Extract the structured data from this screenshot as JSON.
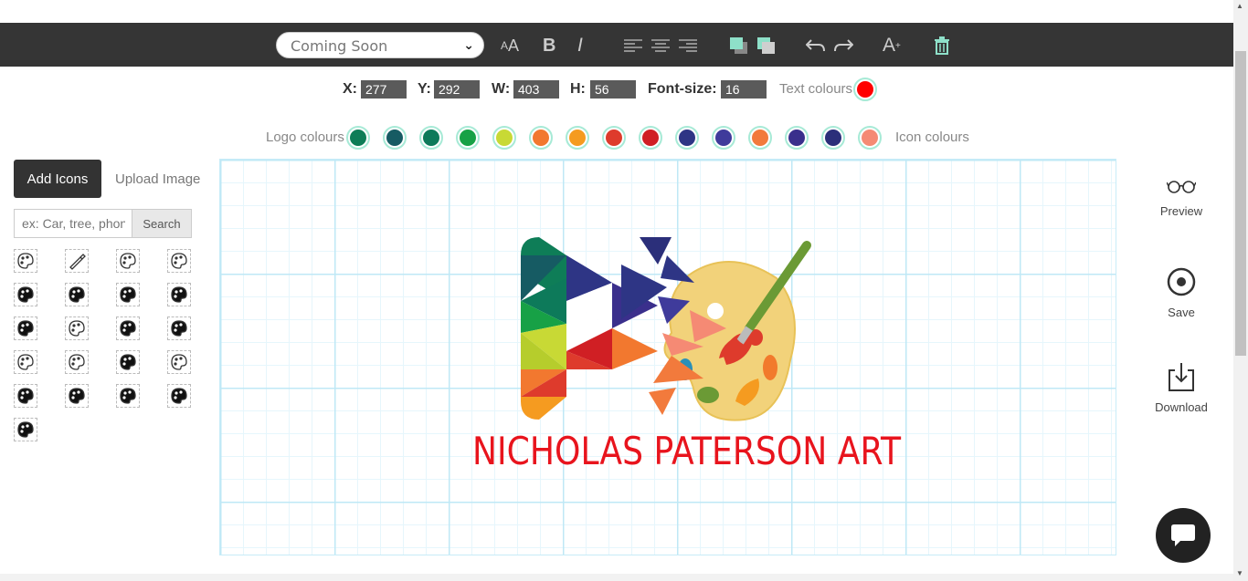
{
  "toolbar": {
    "font_value": "Coming Soon",
    "buttons": {
      "font_size": "AA",
      "bold": "B",
      "italic": "I"
    }
  },
  "coords": {
    "x_label": "X:",
    "x_value": "277",
    "y_label": "Y:",
    "y_value": "292",
    "w_label": "W:",
    "w_value": "403",
    "h_label": "H:",
    "h_value": "56",
    "fontsize_label": "Font-size:",
    "fontsize_value": "16",
    "text_colours_label": "Text colours",
    "text_colour": "#ff0000"
  },
  "palette": {
    "logo_colours_label": "Logo colours",
    "icon_colours_label": "Icon colours",
    "colors": [
      "#0e7d57",
      "#165b63",
      "#0d7a5a",
      "#17a146",
      "#c8d935",
      "#f2782f",
      "#f59b20",
      "#de3b2c",
      "#d01f24",
      "#2e3585",
      "#3f3b9b",
      "#f27a3c",
      "#3a2f8c",
      "#2b2f7a",
      "#f58a74"
    ]
  },
  "left_panel": {
    "add_icons_label": "Add Icons",
    "upload_image_label": "Upload Image",
    "search_placeholder": "ex: Car, tree, phone",
    "search_button": "Search",
    "icons": [
      "palette-icon",
      "brush-icon",
      "palette-icon",
      "palette-icon",
      "palette-icon",
      "palette-icon",
      "palette-icon",
      "palette-icon",
      "palette-icon",
      "palette-icon",
      "palette-icon",
      "palette-icon",
      "palette-icon",
      "palette-icon",
      "palette-icon",
      "palette-icon",
      "palette-icon",
      "palette-icon",
      "palette-icon",
      "palette-icon",
      "palette-icon"
    ]
  },
  "canvas": {
    "logo_text": "NICHOLAS PATERSON ART",
    "logo_text_color": "#e8141d"
  },
  "right_panel": {
    "preview_label": "Preview",
    "save_label": "Save",
    "download_label": "Download"
  }
}
